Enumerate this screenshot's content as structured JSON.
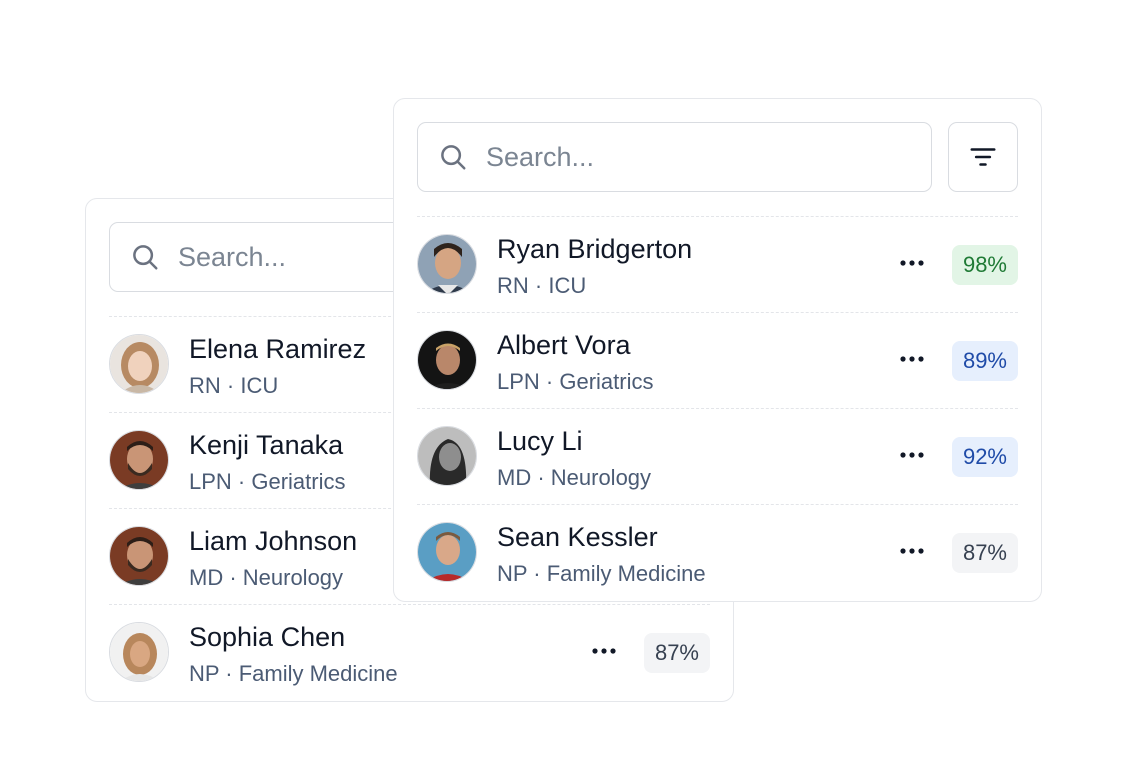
{
  "colors": {
    "badge_green_bg": "#e2f5e6",
    "badge_green_text": "#1f7a35",
    "badge_blue_bg": "#e6effd",
    "badge_blue_text": "#1f4ba8",
    "badge_gray_bg": "#f3f4f6",
    "badge_gray_text": "#374151"
  },
  "icons": {
    "search": "search-icon",
    "filter": "filter-icon",
    "more": "more-horizontal-icon"
  },
  "back_panel": {
    "search": {
      "placeholder": "Search..."
    },
    "people": [
      {
        "name": "Elena Ramirez",
        "role": "RN · ICU"
      },
      {
        "name": "Kenji Tanaka",
        "role": "LPN · Geriatrics"
      },
      {
        "name": "Liam Johnson",
        "role": "MD · Neurology"
      },
      {
        "name": "Sophia Chen",
        "role": "NP · Family Medicine",
        "score": "87%",
        "score_color": "gray"
      }
    ]
  },
  "front_panel": {
    "search": {
      "placeholder": "Search..."
    },
    "people": [
      {
        "name": "Ryan Bridgerton",
        "role": "RN · ICU",
        "score": "98%",
        "score_color": "green"
      },
      {
        "name": "Albert Vora",
        "role": "LPN · Geriatrics",
        "score": "89%",
        "score_color": "blue"
      },
      {
        "name": "Lucy Li",
        "role": "MD · Neurology",
        "score": "92%",
        "score_color": "blue"
      },
      {
        "name": "Sean Kessler",
        "role": "NP · Family Medicine",
        "score": "87%",
        "score_color": "gray"
      }
    ]
  }
}
